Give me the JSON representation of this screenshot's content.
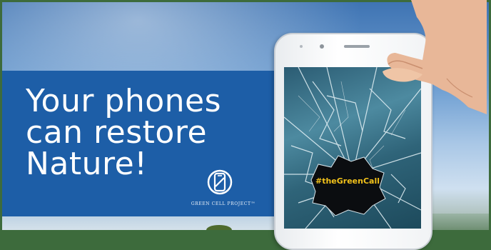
{
  "headline": {
    "line1": "Your phones",
    "line2": "can restore",
    "line3": "Nature!"
  },
  "logo": {
    "icon": "green-cell-logo-icon",
    "text": "GREEN CELL PROJECT™"
  },
  "phone": {
    "screen_icon": "cracked-screen",
    "hashtag": "#theGreenCall"
  },
  "colors": {
    "banner_blue": "#1d5ea7",
    "frame_green": "#3d6b3c",
    "hashtag_yellow": "#f2c21b"
  }
}
